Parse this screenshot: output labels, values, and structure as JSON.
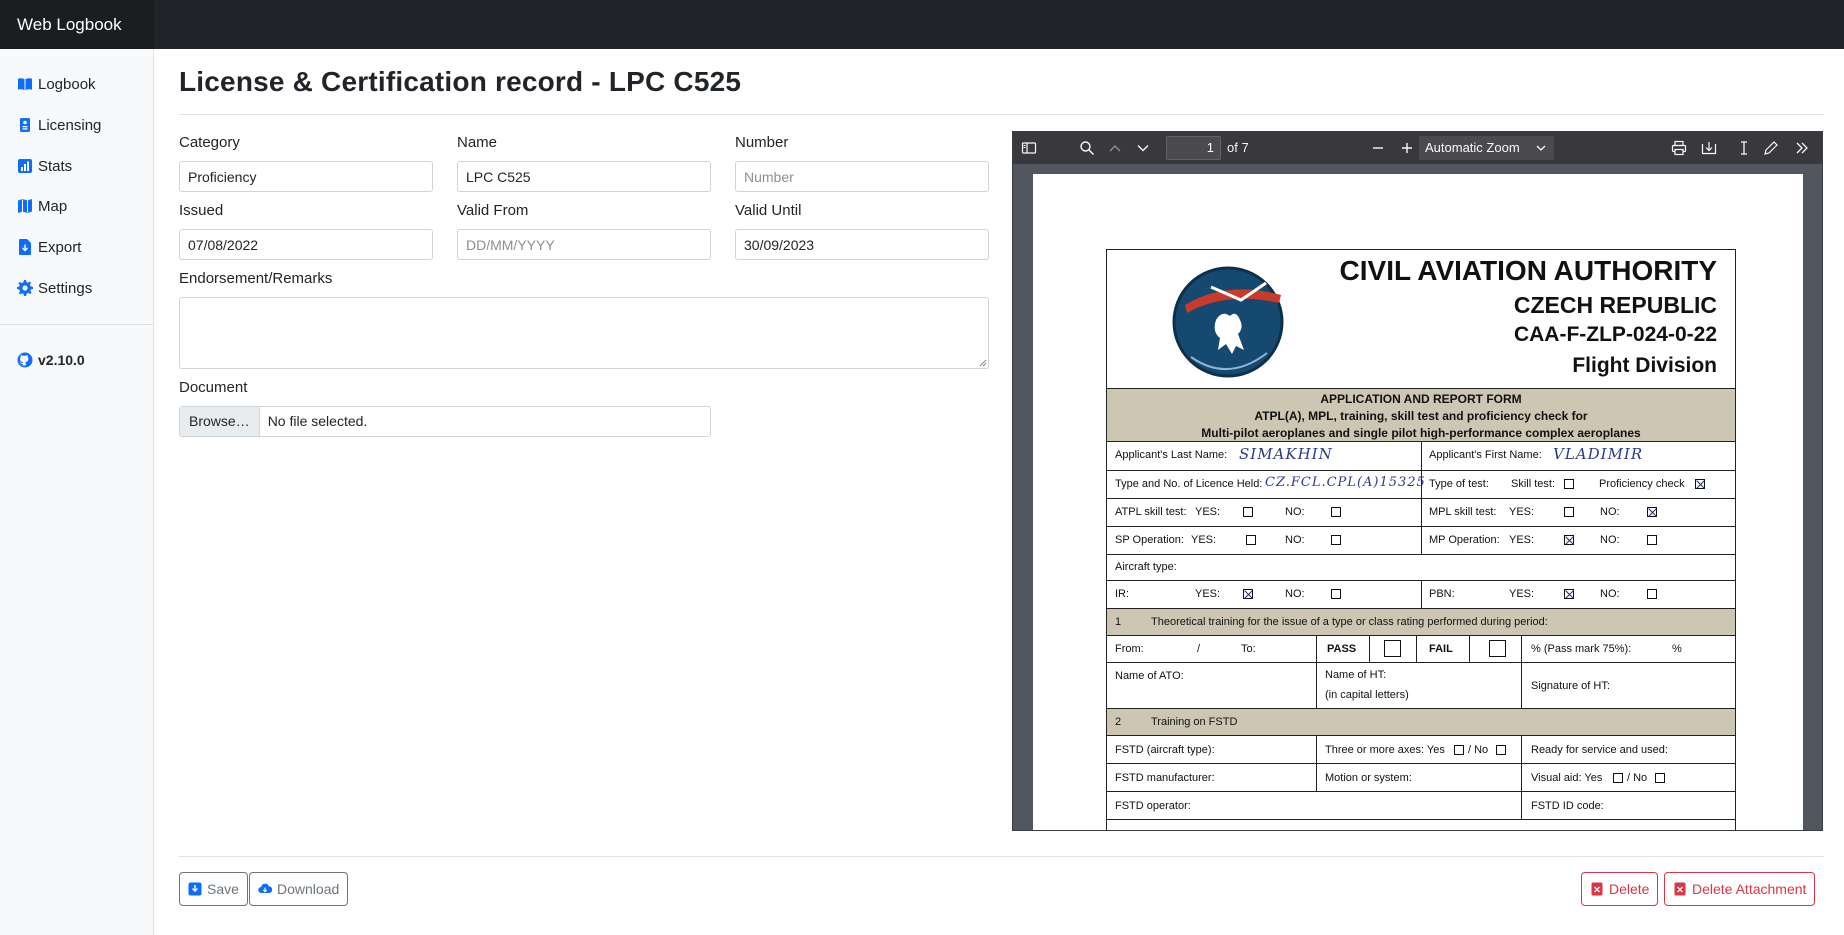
{
  "app": {
    "brand": "Web Logbook",
    "version": "v2.10.0"
  },
  "sidebar": {
    "items": [
      {
        "label": "Logbook",
        "icon": "book-icon"
      },
      {
        "label": "Licensing",
        "icon": "id-card-icon"
      },
      {
        "label": "Stats",
        "icon": "bar-chart-icon"
      },
      {
        "label": "Map",
        "icon": "map-icon"
      },
      {
        "label": "Export",
        "icon": "export-icon"
      },
      {
        "label": "Settings",
        "icon": "gear-icon"
      }
    ]
  },
  "page": {
    "title": "License & Certification record - LPC C525"
  },
  "form": {
    "category": {
      "label": "Category",
      "value": "Proficiency"
    },
    "name": {
      "label": "Name",
      "value": "LPC C525"
    },
    "number": {
      "label": "Number",
      "value": "",
      "placeholder": "Number"
    },
    "issued": {
      "label": "Issued",
      "value": "07/08/2022"
    },
    "valid_from": {
      "label": "Valid From",
      "value": "",
      "placeholder": "DD/MM/YYYY"
    },
    "valid_until": {
      "label": "Valid Until",
      "value": "30/09/2023"
    },
    "remarks": {
      "label": "Endorsement/Remarks",
      "value": ""
    },
    "document": {
      "label": "Document",
      "button": "Browse…",
      "status": "No file selected."
    }
  },
  "viewer": {
    "page_number": "1",
    "page_count_text": "of 7",
    "zoom": "Automatic Zoom"
  },
  "pdf": {
    "authority": "CIVIL AVIATION AUTHORITY",
    "country": "CZECH REPUBLIC",
    "form_code": "CAA-F-ZLP-024-0-22",
    "division": "Flight Division",
    "band_title": "APPLICATION AND REPORT FORM",
    "band_line2": "ATPL(A), MPL, training, skill test and proficiency check for",
    "band_line3": "Multi-pilot aeroplanes and single pilot high-performance complex aeroplanes",
    "last_name_label": "Applicant's Last Name:",
    "last_name_value": "SIMAKHIN",
    "first_name_label": "Applicant's First Name:",
    "first_name_value": "VLADIMIR",
    "licence_label": "Type and No. of Licence Held:",
    "licence_value": "CZ.FCL.CPL(A)15325",
    "type_of_test": "Type of test:",
    "skill_test": "Skill test:",
    "proficiency_check": "Proficiency check",
    "atpl_skill": "ATPL skill test:",
    "mpl_skill": "MPL skill test:",
    "sp_operation": "SP Operation:",
    "mp_operation": "MP Operation:",
    "yes": "YES:",
    "no": "NO:",
    "aircraft_type": "Aircraft type:",
    "ir": "IR:",
    "pbn": "PBN:",
    "sec1_num": "1",
    "sec1_title": "Theoretical training for the issue of a type or class rating performed during period:",
    "from": "From:",
    "slash": "/",
    "to": "To:",
    "pass": "PASS",
    "fail": "FAIL",
    "pass_mark": "% (Pass mark 75%):",
    "percent": "%",
    "name_of_ato": "Name of ATO:",
    "name_of_ht": "Name of HT:",
    "capital_letters": "(in capital letters)",
    "signature_ht": "Signature of HT:",
    "sec2_num": "2",
    "sec2_title": "Training on FSTD",
    "fstd_aircraft": "FSTD (aircraft type):",
    "three_axes": "Three or more axes: Yes",
    "slash_no": "/ No",
    "ready_service": "Ready for service and used:",
    "fstd_manufacturer": "FSTD manufacturer:",
    "motion_system": "Motion or system:",
    "visual_aid": "Visual aid: Yes",
    "fstd_operator": "FSTD operator:",
    "fstd_id": "FSTD ID code:"
  },
  "actions": {
    "save": "Save",
    "download": "Download",
    "delete": "Delete",
    "delete_attachment": "Delete Attachment"
  },
  "colors": {
    "accent": "#0d6efd",
    "danger": "#dc3545",
    "topbar": "#212529"
  }
}
